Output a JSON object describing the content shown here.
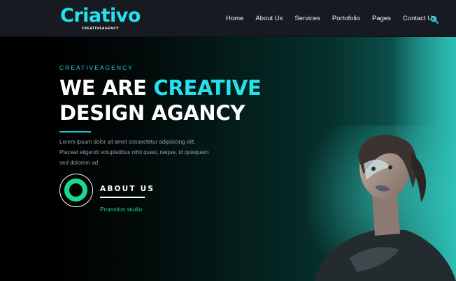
{
  "brand": {
    "name": "Criativo",
    "subtitle": "CREATIVEAGENCY"
  },
  "nav": {
    "items": [
      {
        "label": "Home"
      },
      {
        "label": "About Us"
      },
      {
        "label": "Services"
      },
      {
        "label": "Portofolio"
      },
      {
        "label": "Pages"
      },
      {
        "label": "Contact Us"
      }
    ],
    "search_icon": "search-icon"
  },
  "hero": {
    "tagline": "CREATIVEAGENCY",
    "headline_line1_white": "WE ARE ",
    "headline_line1_accent": "CREATIVE",
    "headline_line2": "DESIGN AGANCY",
    "body": "Lorem ipsum dolor sit amet consectetur adipisicing elit. Placeat eligendi voluptatibus nihil quasi, neque, id quisquam sed dolorem ad",
    "about_label": "ABOUT US",
    "promo": "Promotion studio"
  },
  "colors": {
    "accent": "#22e3ee",
    "green": "#19d98d",
    "nav_bg": "#171b21"
  }
}
